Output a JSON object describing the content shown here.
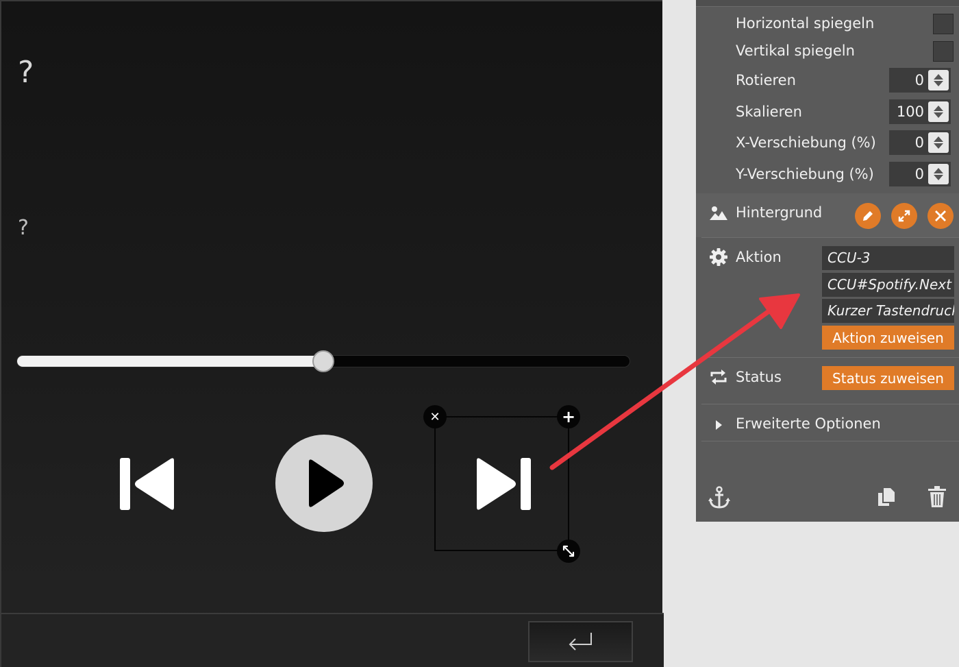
{
  "stage": {
    "placeholder_large": "?",
    "placeholder_small": "?",
    "slider": {
      "value_percent": 50
    }
  },
  "panel": {
    "flip_horizontal_label": "Horizontal spiegeln",
    "flip_vertical_label": "Vertikal spiegeln",
    "rotate_label": "Rotieren",
    "rotate_value": "0",
    "scale_label": "Skalieren",
    "scale_value": "100",
    "x_offset_label": "X-Verschiebung (%)",
    "x_offset_value": "0",
    "y_offset_label": "Y-Verschiebung (%)",
    "y_offset_value": "0",
    "background_label": "Hintergrund",
    "action_label": "Aktion",
    "action_device": "CCU-3",
    "action_datapoint": "CCU#Spotify.Next",
    "action_trigger": "Kurzer Tastendruck",
    "assign_action_label": "Aktion zuweisen",
    "status_label": "Status",
    "assign_status_label": "Status zuweisen",
    "advanced_options_label": "Erweiterte Optionen"
  },
  "colors": {
    "accent": "#e07b28",
    "panel_bg": "#5a5a5a",
    "annotation_arrow": "#e8373f"
  },
  "icons": {
    "background": "image-icon",
    "action": "gear-icon",
    "status": "repeat-icon",
    "advanced": "caret-right-icon",
    "anchor": "anchor-icon",
    "copy": "copy-icon",
    "delete": "trash-icon"
  }
}
